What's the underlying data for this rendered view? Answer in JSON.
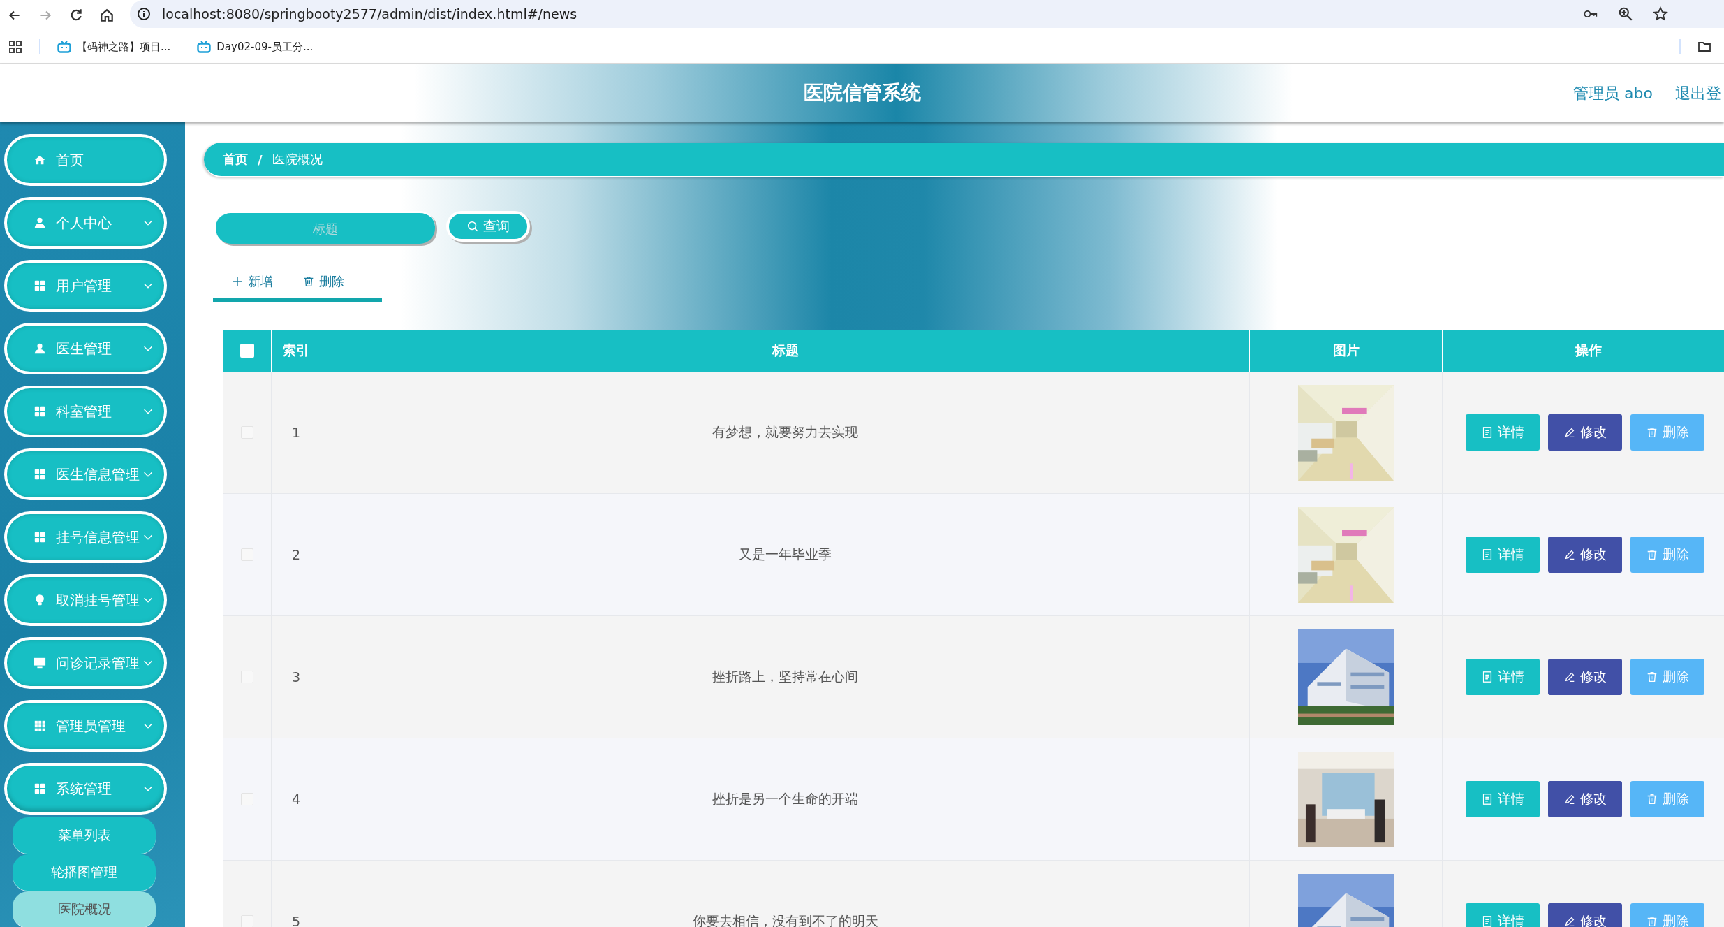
{
  "browser": {
    "url": "localhost:8080/springbooty2577/admin/dist/index.html#/news",
    "bookmarks": [
      "【码神之路】项目...",
      "Day02-09-员工分..."
    ]
  },
  "header": {
    "title": "医院信管系统",
    "user": "管理员 abo",
    "logout": "退出登"
  },
  "sidebar": {
    "items": [
      {
        "label": "首页",
        "kind": "home"
      },
      {
        "label": "个人中心",
        "kind": "user"
      },
      {
        "label": "用户管理",
        "kind": "grid"
      },
      {
        "label": "医生管理",
        "kind": "user"
      },
      {
        "label": "科室管理",
        "kind": "grid"
      },
      {
        "label": "医生信息管理",
        "kind": "grid"
      },
      {
        "label": "挂号信息管理",
        "kind": "grid"
      },
      {
        "label": "取消挂号管理",
        "kind": "bulb"
      },
      {
        "label": "问诊记录管理",
        "kind": "monitor"
      },
      {
        "label": "管理员管理",
        "kind": "grid9"
      },
      {
        "label": "系统管理",
        "kind": "grid",
        "expanded": true,
        "children": [
          {
            "label": "菜单列表",
            "selected": false
          },
          {
            "label": "轮播图管理",
            "selected": false
          },
          {
            "label": "医院概况",
            "selected": true
          }
        ]
      }
    ]
  },
  "breadcrumb": [
    "首页",
    "医院概况"
  ],
  "breadcrumb_separator": "/",
  "search": {
    "placeholder": "标题",
    "button": "查询"
  },
  "actions": [
    {
      "label": "新增",
      "kind": "add"
    },
    {
      "label": "删除",
      "kind": "delete"
    }
  ],
  "table": {
    "header_checkbox": {
      "checked": false
    },
    "columns": [
      "索引",
      "标题",
      "图片",
      "操作"
    ],
    "rows": [
      {
        "checked": false,
        "index": "1",
        "title": "有梦想，就要努力去实现",
        "buttons": [
          {
            "label": "详情",
            "kind": "detail"
          },
          {
            "label": "修改",
            "kind": "edit"
          },
          {
            "label": "删除",
            "kind": "delete"
          }
        ]
      },
      {
        "checked": false,
        "index": "2",
        "title": "又是一年毕业季",
        "buttons": [
          {
            "label": "详情",
            "kind": "detail"
          },
          {
            "label": "修改",
            "kind": "edit"
          },
          {
            "label": "删除",
            "kind": "delete"
          }
        ]
      },
      {
        "checked": false,
        "index": "3",
        "title": "挫折路上，坚持常在心间",
        "buttons": [
          {
            "label": "详情",
            "kind": "detail"
          },
          {
            "label": "修改",
            "kind": "edit"
          },
          {
            "label": "删除",
            "kind": "delete"
          }
        ]
      },
      {
        "checked": false,
        "index": "4",
        "title": "挫折是另一个生命的开端",
        "buttons": [
          {
            "label": "详情",
            "kind": "detail"
          },
          {
            "label": "修改",
            "kind": "edit"
          },
          {
            "label": "删除",
            "kind": "delete"
          }
        ]
      },
      {
        "checked": false,
        "index": "5",
        "title": "你要去相信，没有到不了的明天",
        "buttons": [
          {
            "label": "详情",
            "kind": "detail"
          },
          {
            "label": "修改",
            "kind": "edit"
          },
          {
            "label": "删除",
            "kind": "delete"
          }
        ]
      }
    ]
  }
}
